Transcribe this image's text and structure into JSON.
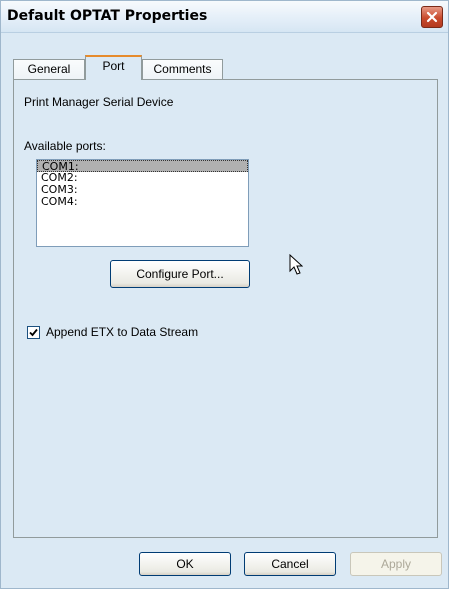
{
  "window": {
    "title": "Default OPTAT Properties",
    "close_icon": "close-x-icon"
  },
  "tabs": [
    {
      "label": "General",
      "active": false
    },
    {
      "label": "Port",
      "active": true
    },
    {
      "label": "Comments",
      "active": false
    }
  ],
  "port_panel": {
    "device_label": "Print Manager Serial Device",
    "available_ports_label": "Available ports:",
    "ports": [
      "COM1:",
      "COM2:",
      "COM3:",
      "COM4:"
    ],
    "selected_port": "COM1:",
    "configure_button": "Configure Port...",
    "append_etx": {
      "label": "Append ETX to Data Stream",
      "checked": true
    }
  },
  "footer": {
    "ok": "OK",
    "cancel": "Cancel",
    "apply": "Apply",
    "apply_enabled": false
  },
  "colors": {
    "title_close_red": "#c94a2d",
    "tab_active_accent": "#e68b2c",
    "dialog_bg": "#dbe9f4"
  }
}
